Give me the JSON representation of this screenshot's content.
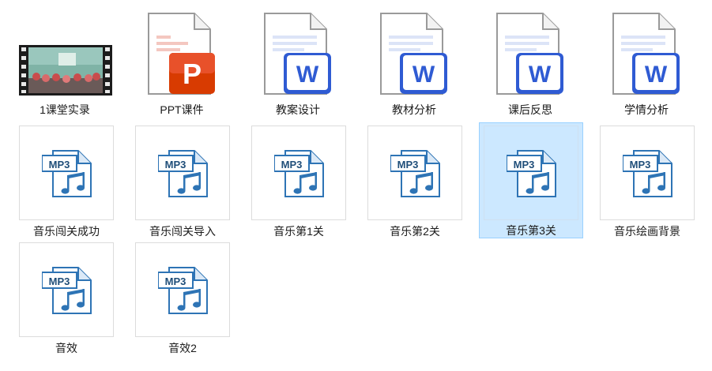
{
  "files": [
    {
      "name": "1课堂实录",
      "type": "video"
    },
    {
      "name": "PPT课件",
      "type": "ppt"
    },
    {
      "name": "教案设计",
      "type": "word"
    },
    {
      "name": "教材分析",
      "type": "word"
    },
    {
      "name": "课后反思",
      "type": "word"
    },
    {
      "name": "学情分析",
      "type": "word"
    },
    {
      "name": "音乐闯关成功",
      "type": "mp3"
    },
    {
      "name": "音乐闯关导入",
      "type": "mp3"
    },
    {
      "name": "音乐第1关",
      "type": "mp3"
    },
    {
      "name": "音乐第2关",
      "type": "mp3"
    },
    {
      "name": "音乐第3关",
      "type": "mp3",
      "selected": true
    },
    {
      "name": "音乐绘画背景",
      "type": "mp3"
    },
    {
      "name": "音效",
      "type": "mp3"
    },
    {
      "name": "音效2",
      "type": "mp3"
    }
  ],
  "icons": {
    "ppt_letter": "P",
    "word_letter": "W",
    "mp3_tag": "MP3"
  },
  "colors": {
    "selection": "#cce8ff",
    "ppt": "#d83b01",
    "word": "#2f5bd3",
    "mp3_blue": "#2e74b5"
  }
}
